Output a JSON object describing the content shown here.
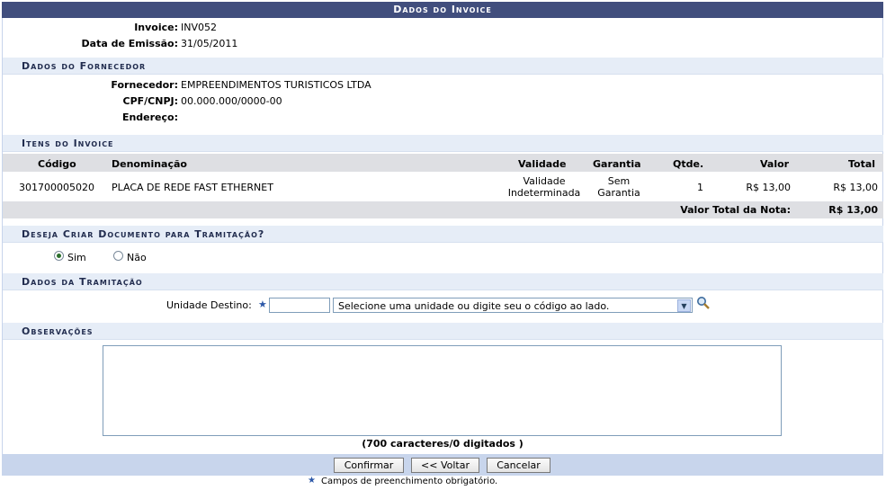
{
  "title": "Dados do Invoice",
  "invoice": {
    "invoice_label": "Invoice:",
    "invoice_value": "INV052",
    "date_label": "Data de Emissão:",
    "date_value": "31/05/2011"
  },
  "supplier": {
    "section_title": "Dados do Fornecedor",
    "name_label": "Fornecedor:",
    "name_value": "EMPREENDIMENTOS TURISTICOS LTDA",
    "doc_label": "CPF/CNPJ:",
    "doc_value": "00.000.000/0000-00",
    "address_label": "Endereço:",
    "address_value": ""
  },
  "items": {
    "section_title": "Itens do Invoice",
    "headers": {
      "code": "Código",
      "name": "Denominação",
      "validity": "Validade",
      "warranty": "Garantia",
      "qty": "Qtde.",
      "value": "Valor",
      "total": "Total"
    },
    "rows": [
      {
        "code": "301700005020",
        "name": "PLACA DE REDE FAST ETHERNET",
        "validity_1": "Validade",
        "validity_2": "Indeterminada",
        "warranty_1": "Sem",
        "warranty_2": "Garantia",
        "qty": "1",
        "value": "R$ 13,00",
        "total": "R$ 13,00"
      }
    ],
    "total_label": "Valor Total da Nota:",
    "total_value": "R$ 13,00"
  },
  "tramitacao_question": {
    "section_title": "Deseja Criar Documento para Tramitação?",
    "yes_label": "Sim",
    "no_label": "Não",
    "selected": "Sim"
  },
  "tramitacao": {
    "section_title": "Dados da Tramitação",
    "unit_label": "Unidade Destino:",
    "unit_code_value": "",
    "unit_select_value": "Selecione uma unidade ou digite seu o código ao lado."
  },
  "observations": {
    "section_title": "Observações",
    "text": "",
    "counter": "(700 caracteres/0 digitados )"
  },
  "buttons": {
    "confirm": "Confirmar",
    "back": "<< Voltar",
    "cancel": "Cancelar"
  },
  "footnote": "Campos de preenchimento obrigatório.",
  "colors": {
    "title_bg": "#414e7d",
    "section_bg": "#e6edf7",
    "bar_bg": "#c8d5ec",
    "required_star": "#2c58a8"
  }
}
